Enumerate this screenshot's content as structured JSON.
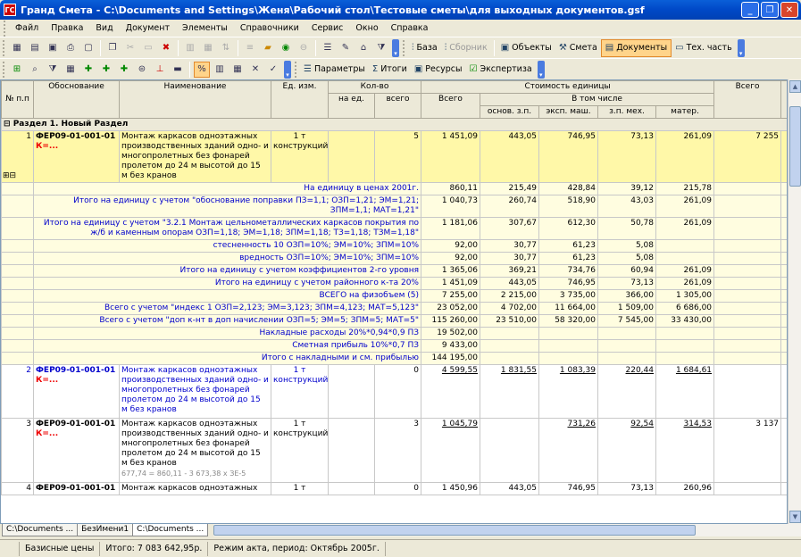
{
  "window": {
    "title": "Гранд Смета - C:\\Documents and Settings\\Женя\\Рабочий стол\\Тестовые сметы\\для выходных документов.gsf",
    "app_icon": "ГС"
  },
  "menu": [
    "Файл",
    "Правка",
    "Вид",
    "Документ",
    "Элементы",
    "Справочники",
    "Сервис",
    "Окно",
    "Справка"
  ],
  "toolbar1": {
    "base": "База",
    "collection": "Сборник",
    "objects": "Объекты",
    "estimate": "Смета",
    "documents": "Документы",
    "tech": "Тех. часть"
  },
  "toolbar2": {
    "params": "Параметры",
    "totals": "Итоги",
    "resources": "Ресурсы",
    "expertise": "Экспертиза",
    "pct_icon": "%"
  },
  "header": {
    "num": "№ п.п",
    "basis": "Обоснование",
    "name": "Наименование",
    "unit": "Ед. изм.",
    "qty": "Кол-во",
    "qty_per": "на ед.",
    "qty_total": "всего",
    "unit_cost": "Стоимость единицы",
    "total": "Всего",
    "incl": "В том числе",
    "oz": "основ. з.п.",
    "em": "эксп. маш.",
    "zpm": "з.п. мех.",
    "mat": "матер.",
    "grand_total": "Всего"
  },
  "section": {
    "title": "Раздел 1. Новый Раздел"
  },
  "row1": {
    "num": "1",
    "code": "ФЕР09-01-001-01",
    "k": "К=...",
    "name": "Монтаж каркасов одноэтажных производственных зданий одно- и многопролетных без фонарей пролетом до 24 м высотой до 15 м без кранов",
    "unit": "1 т конструкций",
    "qty_total": "5",
    "total": "1 451,09",
    "oz": "443,05",
    "em": "746,95",
    "zpm": "73,13",
    "mat": "261,09",
    "grand": "7 255"
  },
  "summary": [
    {
      "label": "На единицу в ценах 2001г.",
      "total": "860,11",
      "oz": "215,49",
      "em": "428,84",
      "zpm": "39,12",
      "mat": "215,78"
    },
    {
      "label": "Итого на единицу с учетом \"обоснование поправки ПЗ=1,1; ОЗП=1,21; ЭМ=1,21; ЗПМ=1,1; МАТ=1,21\"",
      "total": "1 040,73",
      "oz": "260,74",
      "em": "518,90",
      "zpm": "43,03",
      "mat": "261,09"
    },
    {
      "label": "Итого на единицу с учетом \"3.2.1 Монтаж цельнометаллических каркасов покрытия по ж/б и каменным опорам ОЗП=1,18; ЭМ=1,18; ЗПМ=1,18; ТЗ=1,18; ТЗМ=1,18\"",
      "total": "1 181,06",
      "oz": "307,67",
      "em": "612,30",
      "zpm": "50,78",
      "mat": "261,09"
    },
    {
      "label": "стесненность 10 ОЗП=10%; ЭМ=10%; ЗПМ=10%",
      "total": "92,00",
      "oz": "30,77",
      "em": "61,23",
      "zpm": "5,08",
      "mat": ""
    },
    {
      "label": "вредность ОЗП=10%; ЭМ=10%; ЗПМ=10%",
      "total": "92,00",
      "oz": "30,77",
      "em": "61,23",
      "zpm": "5,08",
      "mat": ""
    },
    {
      "label": "Итого на единицу с учетом коэффициентов 2-го уровня",
      "total": "1 365,06",
      "oz": "369,21",
      "em": "734,76",
      "zpm": "60,94",
      "mat": "261,09"
    },
    {
      "label": "Итого на единицу с учетом районного к-та 20%",
      "total": "1 451,09",
      "oz": "443,05",
      "em": "746,95",
      "zpm": "73,13",
      "mat": "261,09"
    },
    {
      "label": "ВСЕГО на физобъем (5)",
      "total": "7 255,00",
      "oz": "2 215,00",
      "em": "3 735,00",
      "zpm": "366,00",
      "mat": "1 305,00"
    },
    {
      "label": "Всего с учетом \"индекс 1 ОЗП=2,123; ЭМ=3,123; ЗПМ=4,123; МАТ=5,123\"",
      "total": "23 052,00",
      "oz": "4 702,00",
      "em": "11 664,00",
      "zpm": "1 509,00",
      "mat": "6 686,00"
    },
    {
      "label": "Всего с учетом \"доп к-нт в доп начислении ОЗП=5; ЭМ=5; ЗПМ=5; МАТ=5\"",
      "total": "115 260,00",
      "oz": "23 510,00",
      "em": "58 320,00",
      "zpm": "7 545,00",
      "mat": "33 430,00"
    },
    {
      "label": "Накладные расходы 20%*0,94*0,9 ПЗ",
      "total": "19 502,00",
      "oz": "",
      "em": "",
      "zpm": "",
      "mat": ""
    },
    {
      "label": "Сметная прибыль 10%*0,7 ПЗ",
      "total": "9 433,00",
      "oz": "",
      "em": "",
      "zpm": "",
      "mat": ""
    },
    {
      "label": "Итого с накладными и см. прибылью",
      "total": "144 195,00",
      "oz": "",
      "em": "",
      "zpm": "",
      "mat": ""
    }
  ],
  "row2": {
    "num": "2",
    "code": "ФЕР09-01-001-01",
    "k": "К=...",
    "name": "Монтаж каркасов одноэтажных производственных зданий одно- и многопролетных без фонарей пролетом до 24 м высотой до 15 м без кранов",
    "unit": "1 т конструкций",
    "qty_total": "0",
    "total": "4 599,55",
    "oz": "1 831,55",
    "em": "1 083,39",
    "zpm": "220,44",
    "mat": "1 684,61",
    "grand": ""
  },
  "row3": {
    "num": "3",
    "code": "ФЕР09-01-001-01",
    "k": "К=...",
    "name": "Монтаж каркасов одноэтажных производственных зданий одно- и многопролетных без фонарей пролетом до 24 м высотой до 15 м без кранов",
    "note": "677,74 = 860,11 - 3 673,38 x ЗЕ-5",
    "unit": "1 т конструкций",
    "qty_total": "3",
    "total": "1 045,79",
    "oz": "",
    "em": "731,26",
    "zpm": "92,54",
    "mat": "314,53",
    "grand": "3 137"
  },
  "row4": {
    "num": "4",
    "code": "ФЕР09-01-001-01",
    "name": "Монтаж каркасов одноэтажных",
    "unit": "1 т",
    "qty_total": "0",
    "total": "1 450,96",
    "oz": "443,05",
    "em": "746,95",
    "zpm": "73,13",
    "mat": "260,96",
    "grand": ""
  },
  "tabs": [
    "C:\\Documents ...",
    "БезИмени1",
    "C:\\Documents ..."
  ],
  "status": {
    "prices": "Базисные цены",
    "total": "Итого: 7 083 642,95р.",
    "mode": "Режим акта, период: Октябрь 2005г."
  }
}
